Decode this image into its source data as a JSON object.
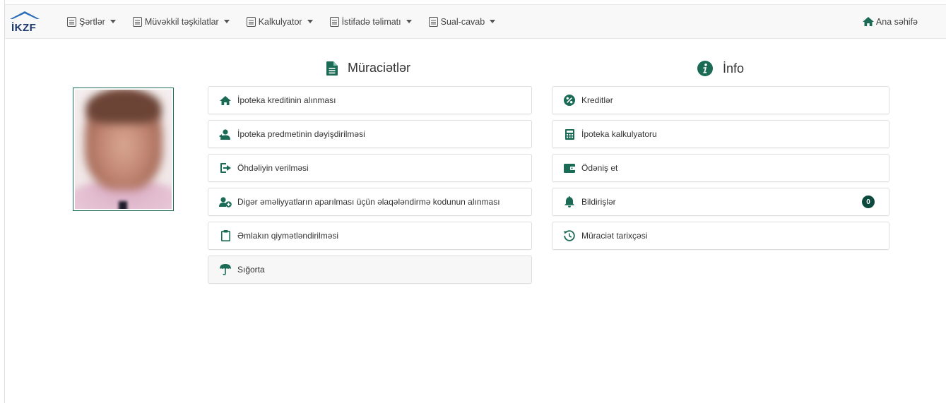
{
  "brand": {
    "logo_text": "İKZF",
    "color": "#1b3a6b"
  },
  "colors": {
    "accent": "#1a6a55",
    "badge": "#0b4a3c"
  },
  "nav": {
    "items": [
      {
        "label": "Şərtlər",
        "icon": "document-icon"
      },
      {
        "label": "Müvəkkil təşkilatlar",
        "icon": "document-icon"
      },
      {
        "label": "Kalkulyator",
        "icon": "document-icon"
      },
      {
        "label": "İstifadə təlimatı",
        "icon": "document-icon"
      },
      {
        "label": "Sual-cavab",
        "icon": "document-icon"
      }
    ],
    "home_label": "Ana səhifə"
  },
  "applications": {
    "title": "Müraciətlər",
    "items": [
      {
        "label": "İpoteka kreditinin alınması",
        "icon": "home-icon"
      },
      {
        "label": "İpoteka predmetinin dəyişdirilməsi",
        "icon": "user-swap-icon"
      },
      {
        "label": "Öhdəliyin verilməsi",
        "icon": "sign-out-icon"
      },
      {
        "label": "Digər əməliyyatların aparılması üçün əlaqələndirmə kodunun alınması",
        "icon": "user-plus-icon"
      },
      {
        "label": "Əmlakın qiymətləndirilməsi",
        "icon": "clipboard-icon"
      },
      {
        "label": "Sığorta",
        "icon": "umbrella-icon"
      }
    ]
  },
  "info": {
    "title": "İnfo",
    "items": [
      {
        "label": "Kreditlər",
        "icon": "percent-icon"
      },
      {
        "label": "İpoteka kalkulyatoru",
        "icon": "calculator-icon"
      },
      {
        "label": "Ödəniş et",
        "icon": "wallet-icon"
      },
      {
        "label": "Bildirişlər",
        "icon": "bell-icon",
        "badge": "0"
      },
      {
        "label": "Müraciət tarixçəsi",
        "icon": "history-icon"
      }
    ]
  }
}
